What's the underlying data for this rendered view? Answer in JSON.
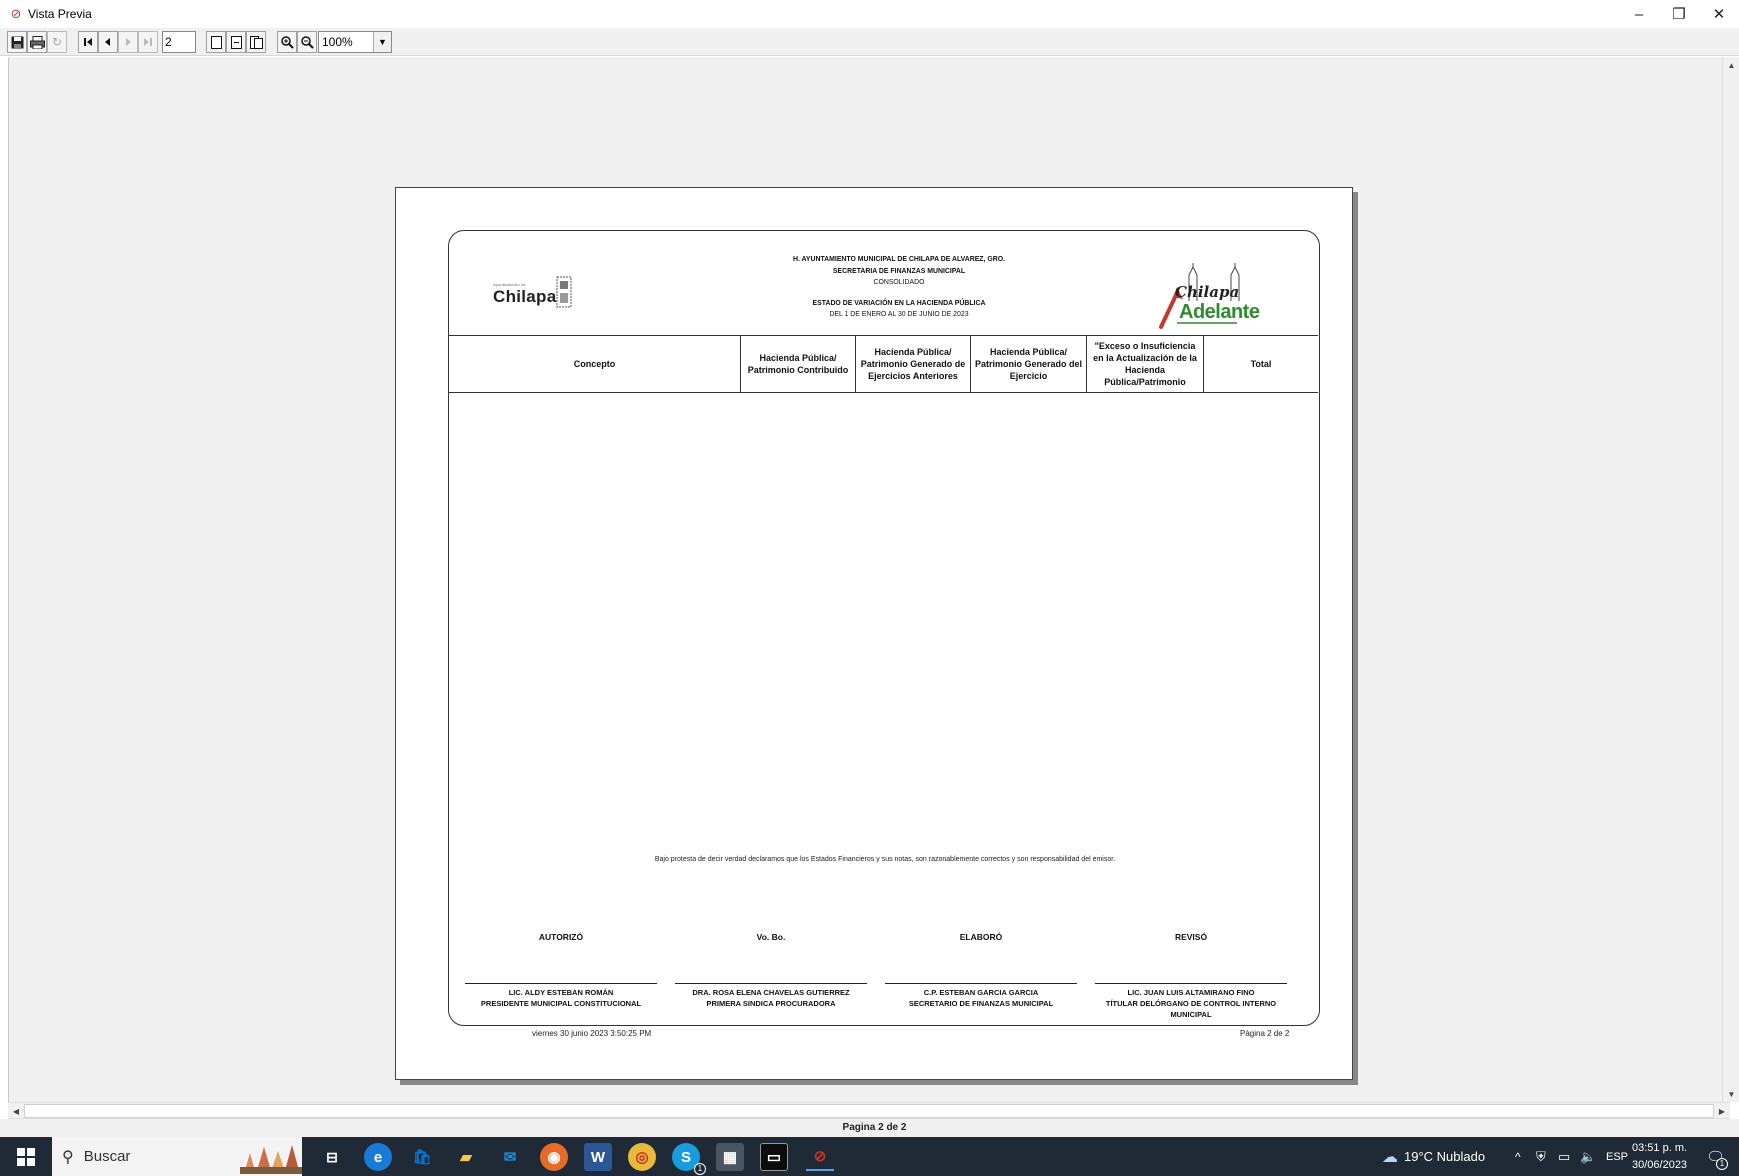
{
  "window": {
    "title": "Vista Previa",
    "controls": {
      "minimize": "–",
      "restore": "❐",
      "close": "✕"
    }
  },
  "toolbar": {
    "page_number": "2",
    "zoom": "100%",
    "zoom_arrow": "▼"
  },
  "report": {
    "header": {
      "line1": "H. AYUNTAMIENTO MUNICIPAL DE CHILAPA DE ALVAREZ, GRO.",
      "line2": "SECRETARIA DE FINANZAS MUNICIPAL",
      "line3": "CONSOLIDADO",
      "line4": "ESTADO DE VARIACIÓN EN LA HACIENDA PÚBLICA",
      "line5": "DEL 1 DE ENERO AL 30 DE JUNIO DE 2023"
    },
    "logo_left": {
      "word": "Chilapa",
      "small": "Ayuntamiento de"
    },
    "logo_right": {
      "line1": "Chilapa",
      "line2": "Adelante"
    },
    "columns": [
      "Concepto",
      "Hacienda Pública/ Patrimonio Contribuido",
      "Hacienda Pública/ Patrimonio Generado de Ejercicios Anteriores",
      "Hacienda Pública/ Patrimonio Generado del Ejercicio",
      "\"Exceso o Insuficiencia en la Actualización de la Hacienda Pública/Patrimonio",
      "Total"
    ],
    "disclaimer": "Bajo protesta de decir verdad declaramos que los Estados Financieros y sus notas, son razonablemente correctos y son responsabilidad del emisor.",
    "signatures": [
      {
        "title": "AUTORIZÓ",
        "name": "LIC. ALDY ESTEBAN ROMÁN",
        "role": "PRESIDENTE MUNICIPAL CONSTITUCIONAL"
      },
      {
        "title": "Vo. Bo.",
        "name": "DRA. ROSA ELENA CHAVELAS GUTIERREZ",
        "role": "PRIMERA SINDICA PROCURADORA"
      },
      {
        "title": "ELABORÓ",
        "name": "C.P. ESTEBAN GARCIA GARCIA",
        "role": "SECRETARIO DE FINANZAS MUNICIPAL"
      },
      {
        "title": "REVISÓ",
        "name": "LIC. JUAN LUIS ALTAMIRANO FINO",
        "role": "TÍTULAR DELÓRGANO DE CONTROL INTERNO MUNICIPAL"
      }
    ],
    "footer_date": "viernes 30 junio 2023 3:50:25 PM",
    "footer_page": "Pàgina 2 de 2"
  },
  "status": {
    "text": "Pagina 2 de 2"
  },
  "taskbar": {
    "search_placeholder": "Buscar",
    "weather": "19°C  Nublado",
    "language": "ESP",
    "time": "03:51 p. m.",
    "date": "30/06/2023",
    "skype_badge": "1",
    "notif_badge": "1"
  },
  "colors": {
    "accent_red": "#c0392b",
    "logo_green": "#2e8b2e",
    "taskbar_bg": "#1f2a36"
  }
}
